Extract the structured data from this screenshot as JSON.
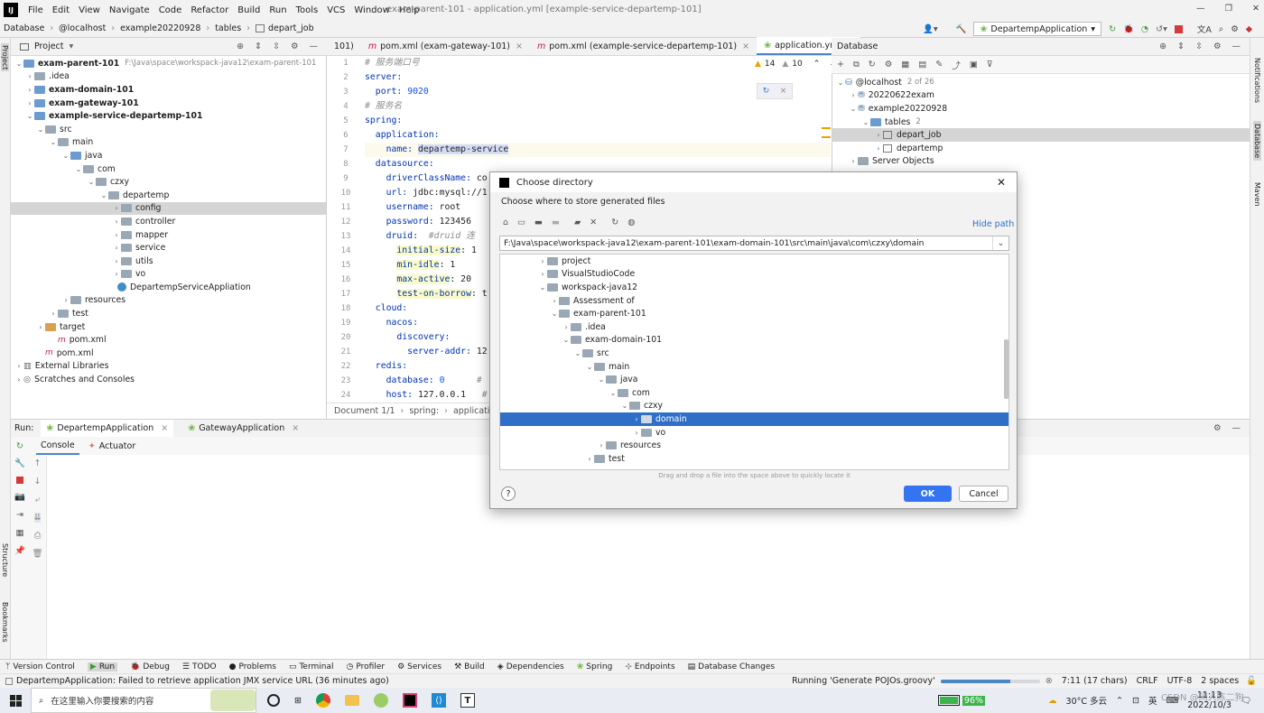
{
  "menubar": {
    "items": [
      "File",
      "Edit",
      "View",
      "Navigate",
      "Code",
      "Refactor",
      "Build",
      "Run",
      "Tools",
      "VCS",
      "Window",
      "Help"
    ],
    "window_title": "exam-parent-101 - application.yml [example-service-departemp-101]",
    "run_config": "DepartempApplication"
  },
  "navbar": {
    "crumbs": [
      "Database",
      "@localhost",
      "example20220928",
      "tables",
      "depart_job"
    ]
  },
  "project": {
    "header": "Project",
    "tree": [
      {
        "label": "exam-parent-101",
        "extra": "F:\\Java\\space\\workspack-java12\\exam-parent-101",
        "bold": true
      },
      {
        "label": ".idea"
      },
      {
        "label": "exam-domain-101",
        "bold": true
      },
      {
        "label": "exam-gateway-101",
        "bold": true
      },
      {
        "label": "example-service-departemp-101",
        "bold": true
      },
      {
        "label": "src"
      },
      {
        "label": "main"
      },
      {
        "label": "java"
      },
      {
        "label": "com"
      },
      {
        "label": "czxy"
      },
      {
        "label": "departemp"
      },
      {
        "label": "config"
      },
      {
        "label": "controller"
      },
      {
        "label": "mapper"
      },
      {
        "label": "service"
      },
      {
        "label": "utils"
      },
      {
        "label": "vo"
      },
      {
        "label": "DepartempServiceAppliation"
      },
      {
        "label": "resources"
      },
      {
        "label": "test"
      },
      {
        "label": "target"
      },
      {
        "label": "pom.xml"
      },
      {
        "label": "pom.xml"
      },
      {
        "label": "External Libraries"
      },
      {
        "label": "Scratches and Consoles"
      }
    ]
  },
  "editor": {
    "tabs": [
      "101)",
      "pom.xml (exam-gateway-101)",
      "pom.xml (example-service-departemp-101)",
      "application.yml"
    ],
    "warnings": "14",
    "weak_warnings": "10",
    "lines": [
      "1",
      "2",
      "3",
      "4",
      "5",
      "6",
      "7",
      "8",
      "9",
      "10",
      "11",
      "12",
      "13",
      "14",
      "15",
      "16",
      "17",
      "18",
      "19",
      "20",
      "21",
      "22",
      "23",
      "24"
    ],
    "code": {
      "l1": "# 服务端口号",
      "l2k": "server:",
      "l3k": "  port: ",
      "l3v": "9020",
      "l4": "# 服务名",
      "l5k": "spring:",
      "l6k": "  application:",
      "l7k": "    name: ",
      "l7v": "departemp-service",
      "l8k": "  datasource:",
      "l9k": "    driverClassName: ",
      "l9v": "co",
      "l10k": "    url: ",
      "l10v": "jdbc:mysql://1",
      "l11k": "    username: ",
      "l11v": "root",
      "l12k": "    password: ",
      "l12v": "123456",
      "l13k": "    druid:",
      "l13c": "  #druid 连",
      "l14k": "initial-size",
      "l14v": ": 1",
      "l15k": "min-idle",
      "l15v": ": 1",
      "l16k": "max-active",
      "l16v": ": 20",
      "l17k": "test-on-borrow",
      "l17v": ": t",
      "l18k": "  cloud:",
      "l19k": "    nacos:",
      "l20k": "      discovery:",
      "l21k": "        server-addr: ",
      "l21v": "12",
      "l22k": "  redis:",
      "l23k": "    database: ",
      "l23v": "0",
      "l23c": "#",
      "l24k": "    host: ",
      "l24v": "127.0.0.1",
      "l24c": "#"
    },
    "status_doc": "Document 1/1",
    "status_sep1": "spring:",
    "status_sep2": "application"
  },
  "database": {
    "header": "Database",
    "tree": [
      {
        "label": "@localhost",
        "extra": "2 of 26"
      },
      {
        "label": "20220622exam"
      },
      {
        "label": "example20220928"
      },
      {
        "label": "tables",
        "extra": "2"
      },
      {
        "label": "depart_job"
      },
      {
        "label": "departemp"
      },
      {
        "label": "Server Objects"
      }
    ]
  },
  "run": {
    "label": "Run:",
    "tabs": [
      "DepartempApplication",
      "GatewayApplication"
    ],
    "subtabs": [
      "Console",
      "Actuator"
    ]
  },
  "toolwindows": [
    "Version Control",
    "Run",
    "Debug",
    "TODO",
    "Problems",
    "Terminal",
    "Profiler",
    "Services",
    "Build",
    "Dependencies",
    "Spring",
    "Endpoints",
    "Database Changes"
  ],
  "side_labels": {
    "project": "Project",
    "structure": "Structure",
    "bookmarks": "Bookmarks",
    "notifications": "Notifications",
    "database": "Database",
    "maven": "Maven"
  },
  "status": {
    "message": "DepartempApplication: Failed to retrieve application JMX service URL (36 minutes ago)",
    "task": "Running 'Generate POJOs.groovy'",
    "position": "7:11 (17 chars)",
    "line_sep": "CRLF",
    "encoding": "UTF-8",
    "indent": "2 spaces"
  },
  "taskbar": {
    "search_placeholder": "在这里输入你要搜索的内容",
    "battery": "96%",
    "weather": "30°C 多云",
    "ime": "英",
    "time": "11:13",
    "date": "2022/10/3",
    "watermark": "CSDN @闲人陈二狗"
  },
  "dialog": {
    "title": "Choose directory",
    "subtitle": "Choose where to store generated files",
    "hide_path": "Hide path",
    "path": "F:\\Java\\space\\workspack-java12\\exam-parent-101\\exam-domain-101\\src\\main\\java\\com\\czxy\\domain",
    "tree": [
      {
        "label": "project"
      },
      {
        "label": "VisualStudioCode"
      },
      {
        "label": "workspack-java12"
      },
      {
        "label": "Assessment of"
      },
      {
        "label": "exam-parent-101"
      },
      {
        "label": ".idea"
      },
      {
        "label": "exam-domain-101"
      },
      {
        "label": "src"
      },
      {
        "label": "main"
      },
      {
        "label": "java"
      },
      {
        "label": "com"
      },
      {
        "label": "czxy"
      },
      {
        "label": "domain"
      },
      {
        "label": "vo"
      },
      {
        "label": "resources"
      },
      {
        "label": "test"
      }
    ],
    "hint": "Drag and drop a file into the space above to quickly locate it",
    "ok": "OK",
    "cancel": "Cancel",
    "help": "?"
  }
}
